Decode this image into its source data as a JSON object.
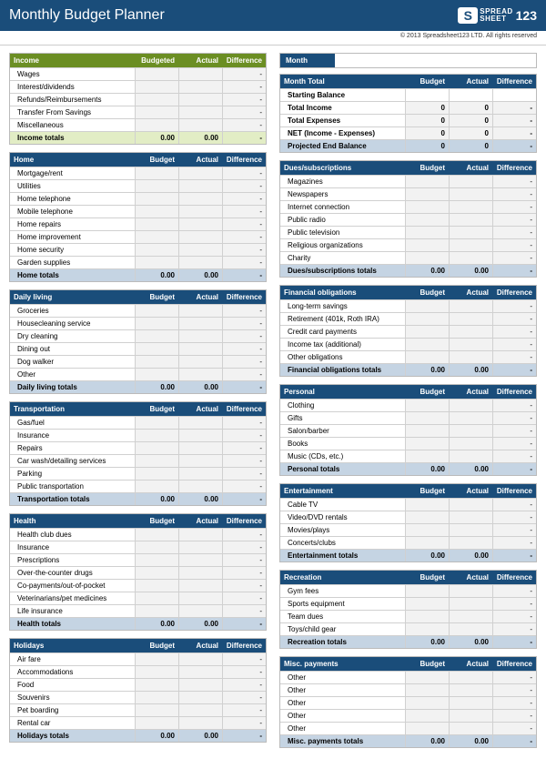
{
  "title": "Monthly Budget Planner",
  "logo": {
    "brand_top": "SPREAD",
    "brand_bottom": "SHEET",
    "number": "123"
  },
  "copyright": "© 2013 Spreadsheet123 LTD. All rights reserved",
  "col_headers": {
    "budget": "Budget",
    "budgeted": "Budgeted",
    "actual": "Actual",
    "difference": "Difference"
  },
  "month": {
    "label": "Month",
    "value": ""
  },
  "summary": {
    "title": "Month Total",
    "rows": [
      {
        "label": "Starting Balance",
        "budget": "",
        "actual": "",
        "diff": "",
        "class": "start"
      },
      {
        "label": "Total Income",
        "budget": "0",
        "actual": "0",
        "diff": "-"
      },
      {
        "label": "Total Expenses",
        "budget": "0",
        "actual": "0",
        "diff": "-"
      },
      {
        "label": "NET (Income - Expenses)",
        "budget": "0",
        "actual": "0",
        "diff": "-"
      },
      {
        "label": "Projected End Balance",
        "budget": "0",
        "actual": "0",
        "diff": "-",
        "class": "proj"
      }
    ]
  },
  "left_sections": [
    {
      "title": "Income",
      "header_class": "green",
      "totals_class": "green",
      "budget_label": "Budgeted",
      "rows": [
        "Wages",
        "Interest/dividends",
        "Refunds/Reimbursements",
        "Transfer From Savings",
        "Miscellaneous"
      ],
      "totals": {
        "label": "Income totals",
        "budget": "0.00",
        "actual": "0.00",
        "diff": "-"
      }
    },
    {
      "title": "Home",
      "header_class": "blue",
      "totals_class": "blue",
      "budget_label": "Budget",
      "rows": [
        "Mortgage/rent",
        "Utilities",
        "Home telephone",
        "Mobile telephone",
        "Home repairs",
        "Home improvement",
        "Home security",
        "Garden supplies"
      ],
      "totals": {
        "label": "Home totals",
        "budget": "0.00",
        "actual": "0.00",
        "diff": "-"
      }
    },
    {
      "title": "Daily living",
      "header_class": "blue",
      "totals_class": "blue",
      "budget_label": "Budget",
      "rows": [
        "Groceries",
        "Housecleaning service",
        "Dry cleaning",
        "Dining out",
        "Dog walker",
        "Other"
      ],
      "totals": {
        "label": "Daily living totals",
        "budget": "0.00",
        "actual": "0.00",
        "diff": "-"
      }
    },
    {
      "title": "Transportation",
      "header_class": "blue",
      "totals_class": "blue",
      "budget_label": "Budget",
      "rows": [
        "Gas/fuel",
        "Insurance",
        "Repairs",
        "Car wash/detailing services",
        "Parking",
        "Public transportation"
      ],
      "totals": {
        "label": "Transportation totals",
        "budget": "0.00",
        "actual": "0.00",
        "diff": "-"
      }
    },
    {
      "title": "Health",
      "header_class": "blue",
      "totals_class": "blue",
      "budget_label": "Budget",
      "rows": [
        "Health club dues",
        "Insurance",
        "Prescriptions",
        "Over-the-counter drugs",
        "Co-payments/out-of-pocket",
        "Veterinarians/pet medicines",
        "Life insurance"
      ],
      "totals": {
        "label": "Health totals",
        "budget": "0.00",
        "actual": "0.00",
        "diff": "-"
      }
    },
    {
      "title": "Holidays",
      "header_class": "blue",
      "totals_class": "blue",
      "budget_label": "Budget",
      "rows": [
        "Air fare",
        "Accommodations",
        "Food",
        "Souvenirs",
        "Pet boarding",
        "Rental car"
      ],
      "totals": {
        "label": "Holidays totals",
        "budget": "0.00",
        "actual": "0.00",
        "diff": "-"
      }
    }
  ],
  "right_sections": [
    {
      "title": "Dues/subscriptions",
      "header_class": "blue",
      "totals_class": "blue",
      "budget_label": "Budget",
      "rows": [
        "Magazines",
        "Newspapers",
        "Internet connection",
        "Public radio",
        "Public television",
        "Religious organizations",
        "Charity"
      ],
      "totals": {
        "label": "Dues/subscriptions totals",
        "budget": "0.00",
        "actual": "0.00",
        "diff": "-"
      }
    },
    {
      "title": "Financial obligations",
      "header_class": "blue",
      "totals_class": "blue",
      "budget_label": "Budget",
      "rows": [
        "Long-term savings",
        "Retirement (401k, Roth IRA)",
        "Credit card payments",
        "Income tax (additional)",
        "Other obligations"
      ],
      "totals": {
        "label": "Financial obligations totals",
        "budget": "0.00",
        "actual": "0.00",
        "diff": "-"
      }
    },
    {
      "title": "Personal",
      "header_class": "blue",
      "totals_class": "blue",
      "budget_label": "Budget",
      "rows": [
        "Clothing",
        "Gifts",
        "Salon/barber",
        "Books",
        "Music (CDs, etc.)"
      ],
      "totals": {
        "label": "Personal totals",
        "budget": "0.00",
        "actual": "0.00",
        "diff": "-"
      }
    },
    {
      "title": "Entertainment",
      "header_class": "blue",
      "totals_class": "blue",
      "budget_label": "Budget",
      "rows": [
        "Cable TV",
        "Video/DVD rentals",
        "Movies/plays",
        "Concerts/clubs"
      ],
      "totals": {
        "label": "Entertainment totals",
        "budget": "0.00",
        "actual": "0.00",
        "diff": "-"
      }
    },
    {
      "title": "Recreation",
      "header_class": "blue",
      "totals_class": "blue",
      "budget_label": "Budget",
      "rows": [
        "Gym fees",
        "Sports equipment",
        "Team dues",
        "Toys/child gear"
      ],
      "totals": {
        "label": "Recreation totals",
        "budget": "0.00",
        "actual": "0.00",
        "diff": "-"
      }
    },
    {
      "title": "Misc. payments",
      "header_class": "blue",
      "totals_class": "blue",
      "budget_label": "Budget",
      "rows": [
        "Other",
        "Other",
        "Other",
        "Other",
        "Other"
      ],
      "totals": {
        "label": "Misc. payments totals",
        "budget": "0.00",
        "actual": "0.00",
        "diff": "-"
      }
    }
  ]
}
